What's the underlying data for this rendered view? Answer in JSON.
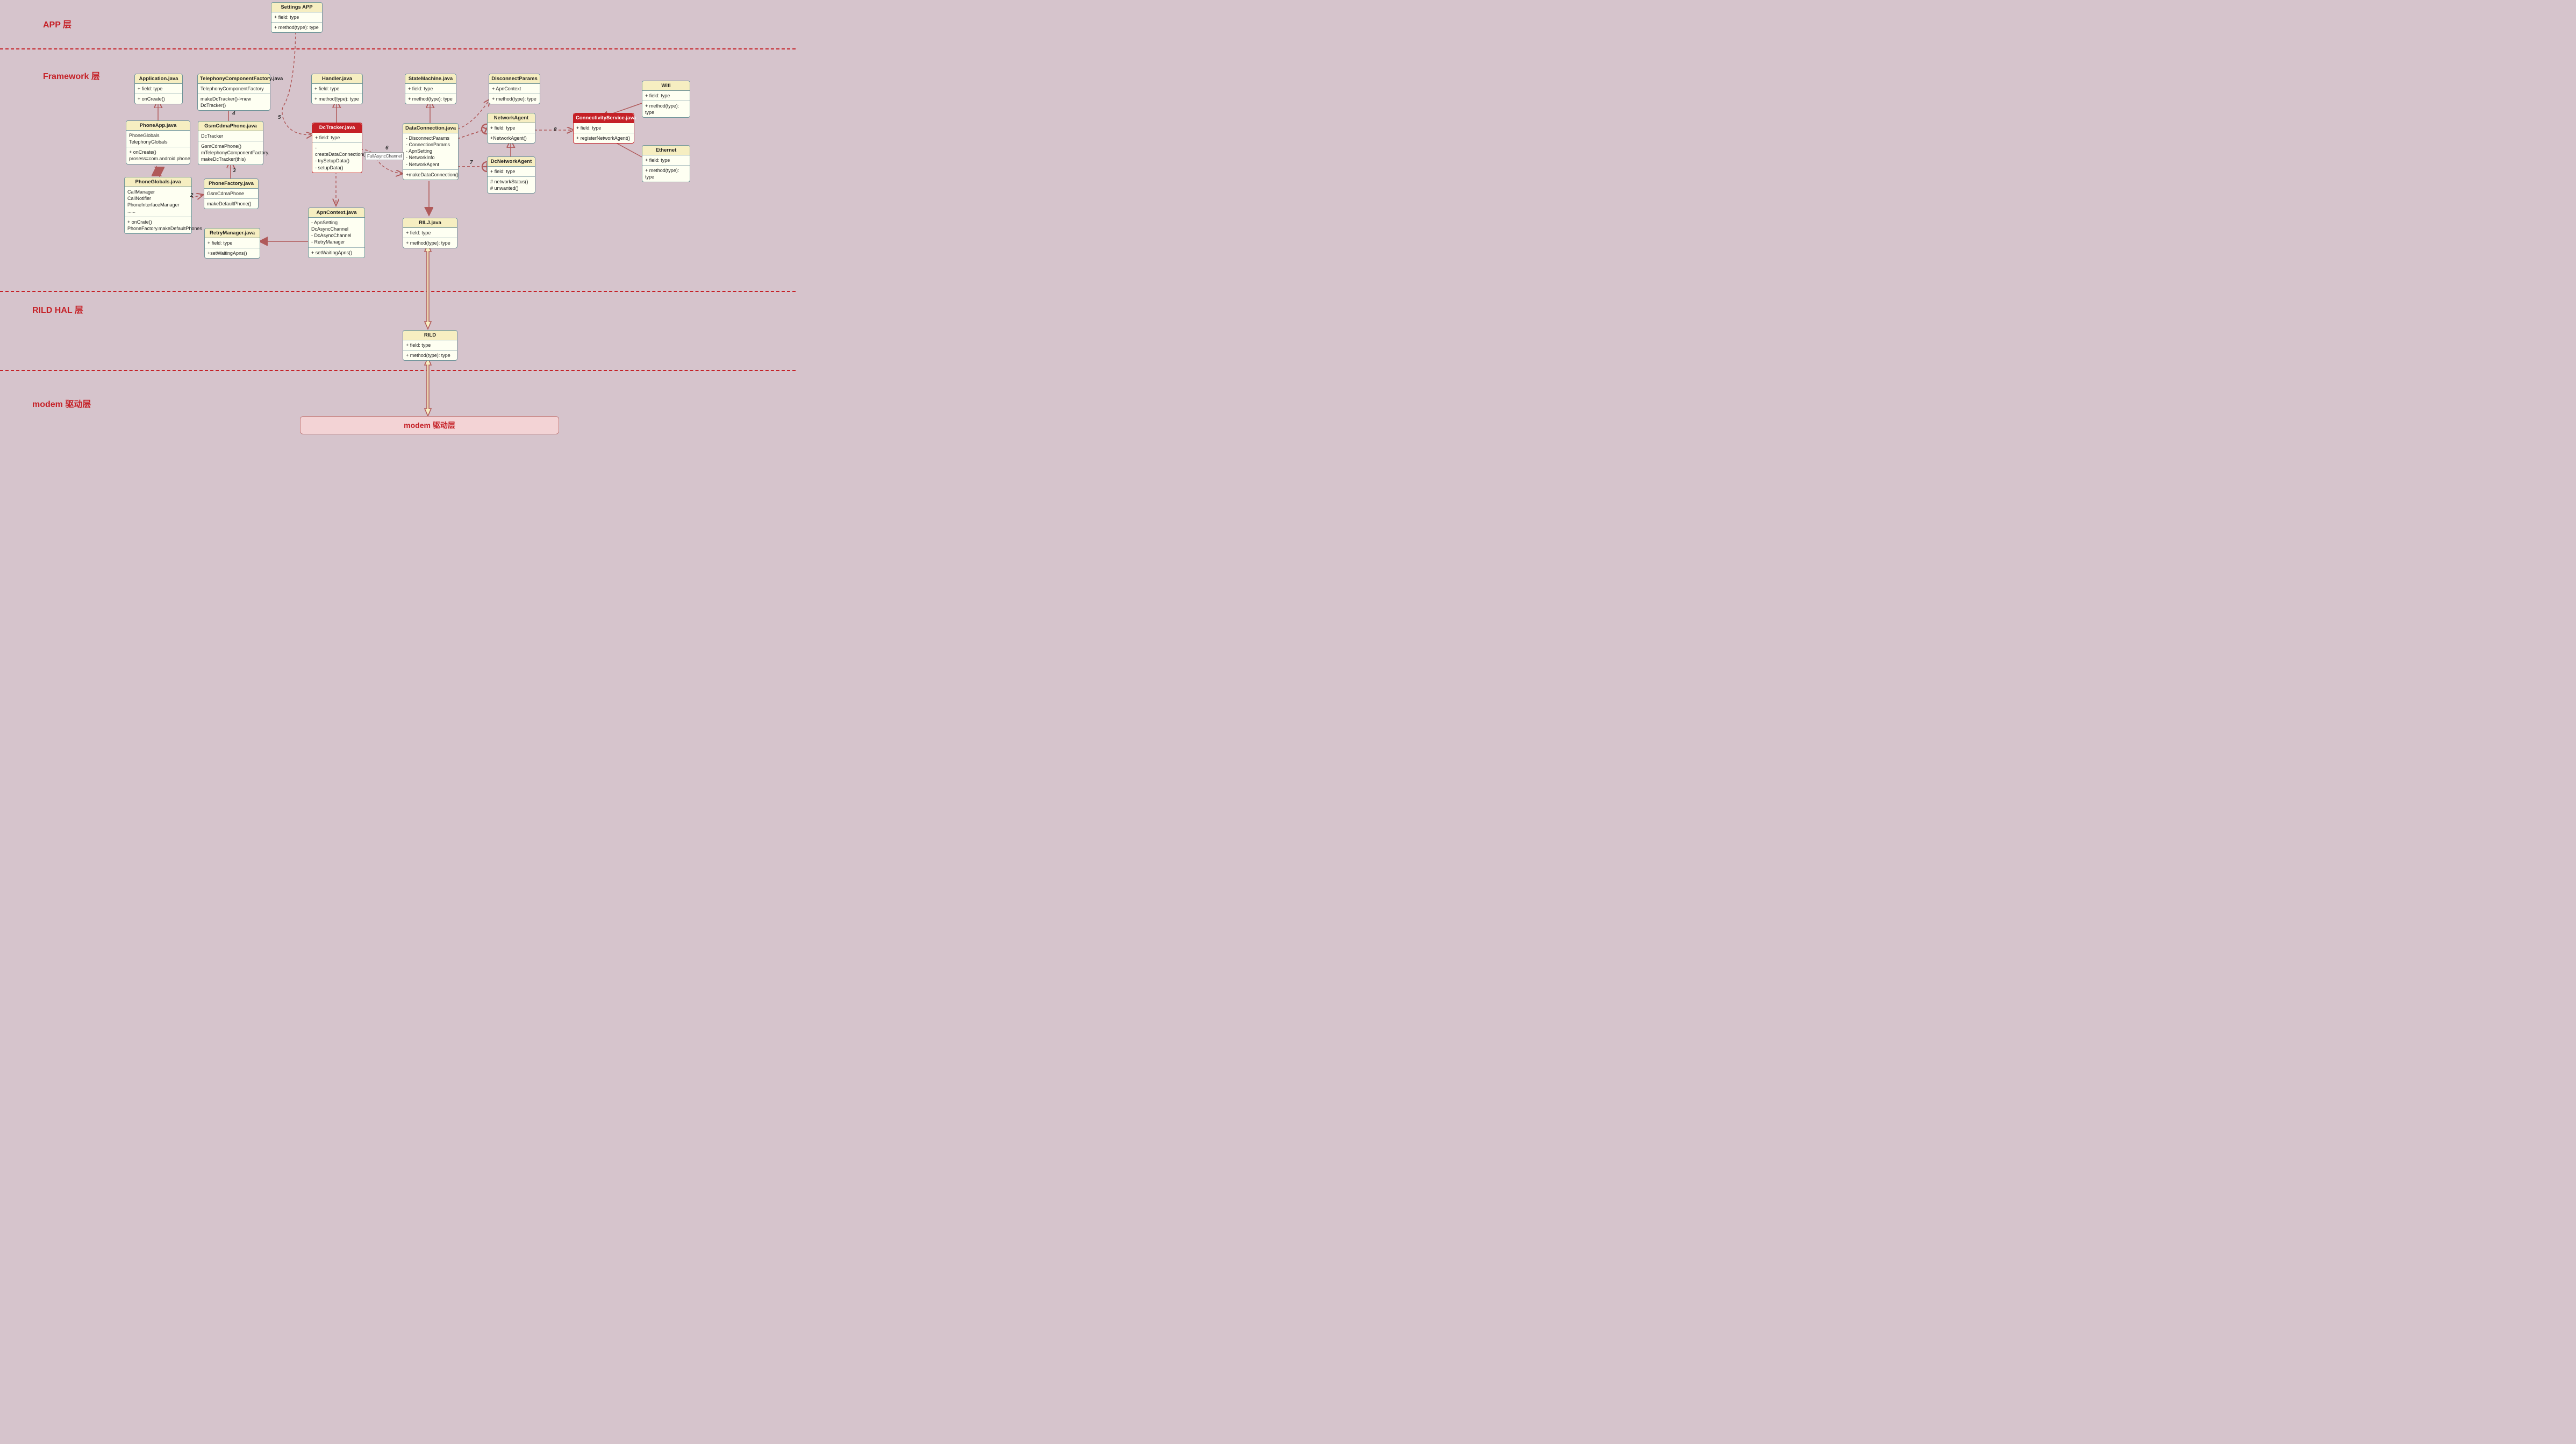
{
  "layers": {
    "app": "APP 层",
    "framework": "Framework 层",
    "rild": "RILD HAL 层",
    "modem": "modem 驱动层"
  },
  "modem_box": "modem 驱动层",
  "annotations": {
    "full_async": "FullAsyncChannel"
  },
  "numbers": {
    "n2": "2",
    "n3": "3",
    "n4": "4",
    "n5": "5",
    "n6": "6",
    "n7": "7",
    "n8": "8"
  },
  "boxes": {
    "settings": {
      "title": "Settings APP",
      "fields": "+ field: type",
      "methods": "+ method(type): type"
    },
    "application": {
      "title": "Application.java",
      "fields": "+ field: type",
      "methods": "+ onCreate()"
    },
    "tcf": {
      "title": "TelephonyComponentFactory.java",
      "fields": "TelephonyComponentFactory",
      "methods": "makeDcTracker()->new DcTracker()"
    },
    "handler": {
      "title": "Handler.java",
      "fields": "+ field: type",
      "methods": "+ method(type): type"
    },
    "sm": {
      "title": "StateMachine.java",
      "fields": "+ field: type",
      "methods": "+ method(type): type"
    },
    "dp": {
      "title": "DisconnectParams",
      "fields": "+ ApnContext",
      "methods": "+ method(type): type"
    },
    "na": {
      "title": "NetworkAgent",
      "fields": "+ field: type",
      "methods": "+NetworkAgent()"
    },
    "wifi": {
      "title": "Wifi",
      "fields": "+ field: type",
      "methods": "+ method(type): type"
    },
    "cs": {
      "title": "ConnectivityService.java",
      "fields": "+ field: type",
      "methods": "+ registerNetworkAgent()"
    },
    "eth": {
      "title": "Ethernet",
      "fields": "+ field: type",
      "methods": "+ method(type): type"
    },
    "phoneapp": {
      "title": "PhoneApp.java",
      "fields": "PhoneGlobals\nTelephonyGlobals",
      "methods": "+ onCreate()\nprosess=com.android.phone"
    },
    "gcp": {
      "title": "GsmCdmaPhone.java",
      "fields": "DcTracker",
      "methods": "GsmCdmaPhone()\nmTelephonyComponentFactory.\nmakeDcTracker(this)"
    },
    "dct": {
      "title": "DcTracker.java",
      "fields": "+ field: type",
      "methods": "- createDataConnection()\n- trySetupData()\n- setupData()"
    },
    "dc": {
      "title": "DataConnection.java",
      "fields": "- DisconnectParams\n- ConnectionParams\n- ApnSetting\n- NetworkInfo\n- NetworkAgent",
      "methods": "+makeDataConnection()"
    },
    "dcna": {
      "title": "DcNetworkAgent",
      "fields": "+ field: type",
      "methods": "# networkStatus()\n# unwanted()"
    },
    "pg": {
      "title": "PhoneGlobals.java",
      "fields": "CallManager\nCallNotifier\nPhoneInterfaceManager\n......",
      "methods": "+ onCrate()\nPhoneFactory.makeDefaultPhones"
    },
    "pf": {
      "title": "PhoneFactory.java",
      "fields": "GsmCdmaPhone",
      "methods": "makeDefaultPhone()"
    },
    "rm": {
      "title": "RetryManager.java",
      "fields": "+ field: type",
      "methods": "+setWaitingApns()"
    },
    "apn": {
      "title": "ApnContext.java",
      "fields": "-  ApnSetting\n  DcAsyncChannel\n-  DcAsyncChannel\n-  RetryManager",
      "methods": "+ setWaitingApns()"
    },
    "rilj": {
      "title": "RILJ.java",
      "fields": "+ field: type",
      "methods": "+ method(type): type"
    },
    "rild": {
      "title": "RILD",
      "fields": "+ field: type",
      "methods": "+ method(type): type"
    }
  }
}
